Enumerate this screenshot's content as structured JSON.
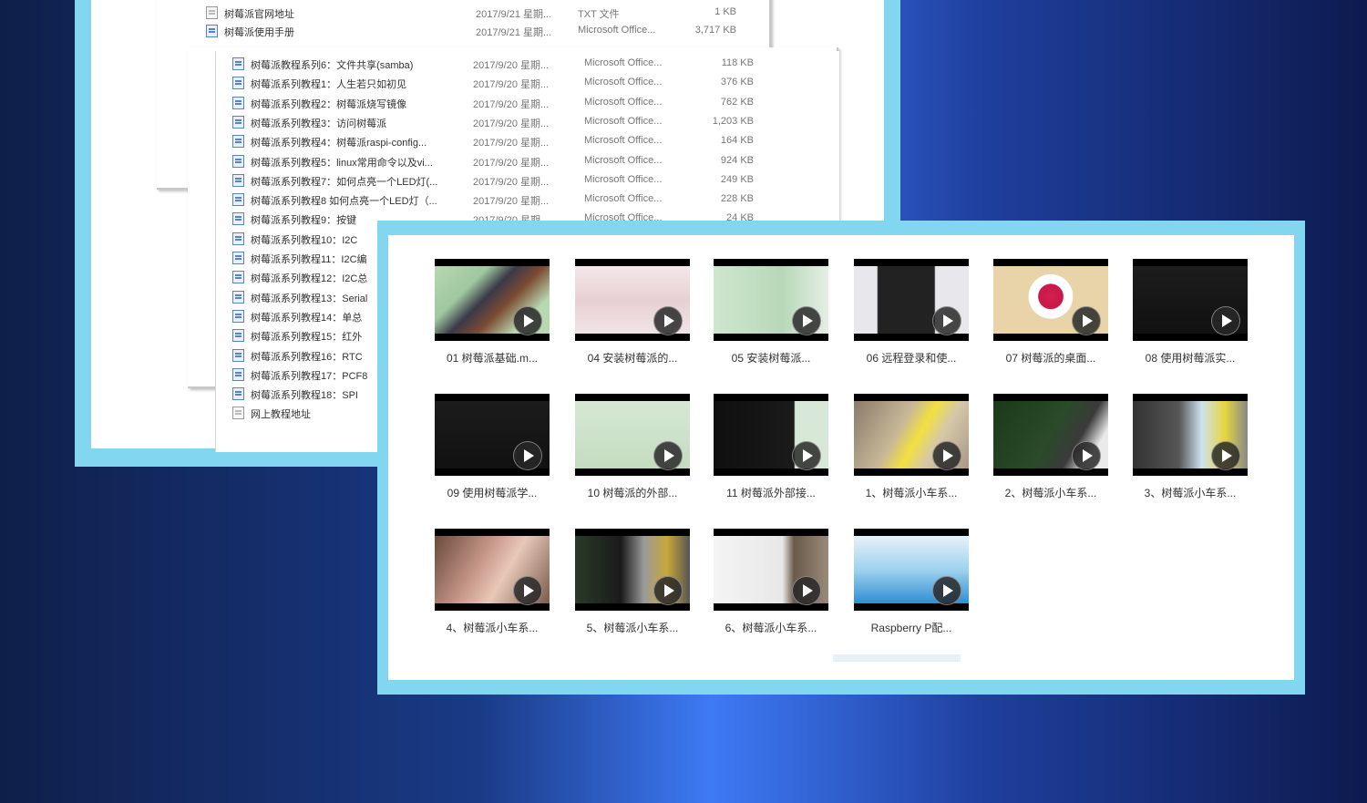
{
  "explorer": {
    "top_rows": [
      {
        "name": "树莓派官网地址",
        "date": "2017/9/21 星期...",
        "type": "TXT 文件",
        "size": "1 KB",
        "icon": "txt-file-icon"
      },
      {
        "name": "树莓派使用手册",
        "date": "2017/9/21 星期...",
        "type": "Microsoft Office...",
        "size": "3,717 KB",
        "icon": "word-file-icon"
      }
    ],
    "rows": [
      {
        "name": "树莓派教程系列6：文件共享(samba)",
        "date": "2017/9/20 星期...",
        "type": "Microsoft Office...",
        "size": "118 KB",
        "icon": "word-file-icon"
      },
      {
        "name": "树莓派系列教程1：人生若只如初见",
        "date": "2017/9/20 星期...",
        "type": "Microsoft Office...",
        "size": "376 KB",
        "icon": "word-file-icon"
      },
      {
        "name": "树莓派系列教程2：树莓派烧写镜像",
        "date": "2017/9/20 星期...",
        "type": "Microsoft Office...",
        "size": "762 KB",
        "icon": "word-file-icon"
      },
      {
        "name": "树莓派系列教程3：访问树莓派",
        "date": "2017/9/20 星期...",
        "type": "Microsoft Office...",
        "size": "1,203 KB",
        "icon": "word-file-icon"
      },
      {
        "name": "树莓派系列教程4：树莓派raspi-config...",
        "date": "2017/9/20 星期...",
        "type": "Microsoft Office...",
        "size": "164 KB",
        "icon": "word-file-icon"
      },
      {
        "name": "树莓派系列教程5：linux常用命令以及vi...",
        "date": "2017/9/20 星期...",
        "type": "Microsoft Office...",
        "size": "924 KB",
        "icon": "word-file-icon"
      },
      {
        "name": "树莓派系列教程7：如何点亮一个LED灯(...",
        "date": "2017/9/20 星期...",
        "type": "Microsoft Office...",
        "size": "249 KB",
        "icon": "word-file-icon"
      },
      {
        "name": "树莓派系列教程8 如何点亮一个LED灯（...",
        "date": "2017/9/20 星期...",
        "type": "Microsoft Office...",
        "size": "228 KB",
        "icon": "word-file-icon"
      },
      {
        "name": "树莓派系列教程9：按键",
        "date": "2017/9/20 星期...",
        "type": "Microsoft Office...",
        "size": "24 KB",
        "icon": "word-file-icon"
      },
      {
        "name": "树莓派系列教程10：I2C",
        "date": "",
        "type": "",
        "size": "",
        "icon": "word-file-icon"
      },
      {
        "name": "树莓派系列教程11：I2C编",
        "date": "",
        "type": "",
        "size": "",
        "icon": "word-file-icon"
      },
      {
        "name": "树莓派系列教程12：I2C总",
        "date": "",
        "type": "",
        "size": "",
        "icon": "word-file-icon"
      },
      {
        "name": "树莓派系列教程13：Serial",
        "date": "",
        "type": "",
        "size": "",
        "icon": "word-file-icon"
      },
      {
        "name": "树莓派系列教程14：单总",
        "date": "",
        "type": "",
        "size": "",
        "icon": "word-file-icon"
      },
      {
        "name": "树莓派系列教程15：红外",
        "date": "",
        "type": "",
        "size": "",
        "icon": "word-file-icon"
      },
      {
        "name": "树莓派系列教程16：RTC",
        "date": "",
        "type": "",
        "size": "",
        "icon": "word-file-icon"
      },
      {
        "name": "树莓派系列教程17：PCF8",
        "date": "",
        "type": "",
        "size": "",
        "icon": "word-file-icon"
      },
      {
        "name": "树莓派系列教程18：SPI",
        "date": "",
        "type": "",
        "size": "",
        "icon": "word-file-icon"
      },
      {
        "name": "网上教程地址",
        "date": "",
        "type": "",
        "size": "",
        "icon": "txt-file-icon"
      }
    ]
  },
  "videos": [
    {
      "title": "01 树莓派基础.m...",
      "scheme": "photo-board"
    },
    {
      "title": "04 安装树莓派的...",
      "scheme": "pinkish-ui"
    },
    {
      "title": "05 安装树莓派...",
      "scheme": "green-term"
    },
    {
      "title": "06 远程登录和使...",
      "scheme": "dark-win"
    },
    {
      "title": "07 树莓派的桌面...",
      "scheme": "rasp-logo"
    },
    {
      "title": "08 使用树莓派实...",
      "scheme": "black-term"
    },
    {
      "title": "09 使用树莓派学...",
      "scheme": "black-term"
    },
    {
      "title": "10 树莓派的外部...",
      "scheme": "green-text"
    },
    {
      "title": "11 树莓派外部接...",
      "scheme": "black-term2"
    },
    {
      "title": "1、树莓派小车系...",
      "scheme": "photo-yellow"
    },
    {
      "title": "2、树莓派小车系...",
      "scheme": "photo-board2"
    },
    {
      "title": "3、树莓派小车系...",
      "scheme": "photo-mix"
    },
    {
      "title": "4、树莓派小车系...",
      "scheme": "photo-hand"
    },
    {
      "title": "5、树莓派小车系...",
      "scheme": "photo-car"
    },
    {
      "title": "6、树莓派小车系...",
      "scheme": "photo-desk"
    },
    {
      "title": "Raspberry P配...",
      "scheme": "blue-grad"
    }
  ],
  "colors": {
    "frame": "#82d6f0",
    "bg_center": "#3e7af5",
    "bg_edge": "#0f1f4a"
  }
}
